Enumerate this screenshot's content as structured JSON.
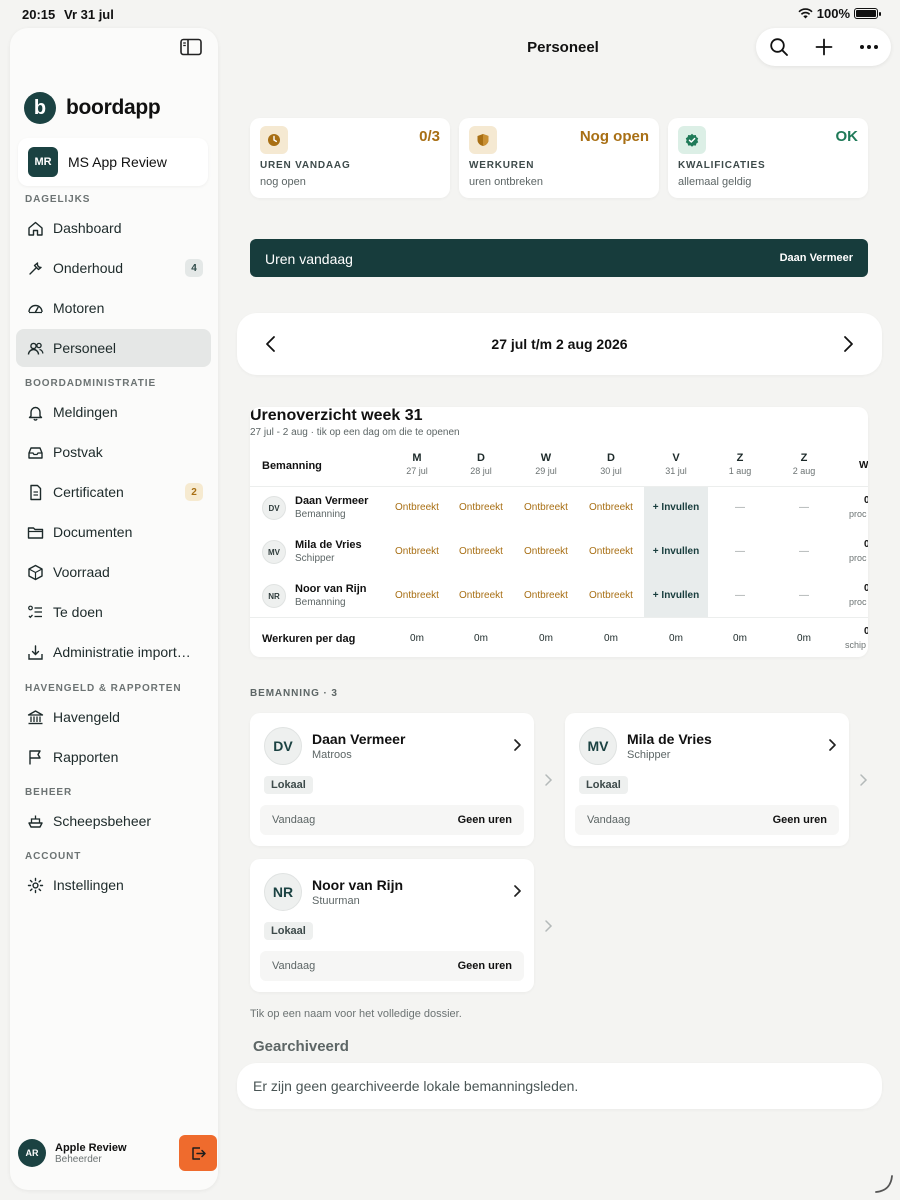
{
  "status_bar": {
    "time": "20:15",
    "date": "Vr 31 jul",
    "battery": "100%"
  },
  "sidebar": {
    "brand": "boordapp",
    "brand_logo": "b",
    "ship": {
      "initials": "MR",
      "name": "MS App Review"
    },
    "sections": {
      "daily": "DAGELIJKS",
      "admin": "BOORDADMINISTRATIE",
      "harbor": "HAVENGELD & RAPPORTEN",
      "manage": "BEHEER",
      "account": "ACCOUNT"
    },
    "items": [
      {
        "label": "Dashboard",
        "icon": "home-icon"
      },
      {
        "label": "Onderhoud",
        "icon": "wrench-icon",
        "badge": "4"
      },
      {
        "label": "Motoren",
        "icon": "gauge-icon"
      },
      {
        "label": "Personeel",
        "icon": "people-icon",
        "active": true
      },
      {
        "label": "Meldingen",
        "icon": "bell-icon"
      },
      {
        "label": "Postvak",
        "icon": "inbox-icon"
      },
      {
        "label": "Certificaten",
        "icon": "document-icon",
        "badge": "2"
      },
      {
        "label": "Documenten",
        "icon": "folder-icon"
      },
      {
        "label": "Voorraad",
        "icon": "box-icon"
      },
      {
        "label": "Te doen",
        "icon": "checklist-icon"
      },
      {
        "label": "Administratie import…",
        "icon": "import-icon"
      },
      {
        "label": "Havengeld",
        "icon": "bank-icon"
      },
      {
        "label": "Rapporten",
        "icon": "flag-icon"
      },
      {
        "label": "Scheepsbeheer",
        "icon": "ship-icon"
      },
      {
        "label": "Instellingen",
        "icon": "gear-icon"
      }
    ],
    "user": {
      "initials": "AR",
      "name": "Apple Review",
      "role": "Beheerder"
    }
  },
  "header": {
    "title": "Personeel"
  },
  "stats": [
    {
      "value": "0/3",
      "label": "UREN VANDAAG",
      "sub": "nog open",
      "color": "#a86f14",
      "icon": "clock-icon"
    },
    {
      "value": "Nog open",
      "label": "WERKUREN",
      "sub": "uren ontbreken",
      "color": "#a86f14",
      "icon": "shield-icon"
    },
    {
      "value": "OK",
      "label": "KWALIFICATIES",
      "sub": "allemaal geldig",
      "color": "#1f7a58",
      "icon": "check-shield-icon"
    }
  ],
  "banner": {
    "title": "Uren vandaag",
    "user": "Daan Vermeer"
  },
  "week_nav": {
    "label": "27 jul t/m 2 aug 2026"
  },
  "hours": {
    "title": "Urenoverzicht week 31",
    "subtitle": "27 jul - 2 aug · tik op een dag om die te openen",
    "name_header": "Bemanning",
    "days": [
      {
        "letter": "M",
        "date": "27 jul"
      },
      {
        "letter": "D",
        "date": "28 jul"
      },
      {
        "letter": "W",
        "date": "29 jul"
      },
      {
        "letter": "D",
        "date": "30 jul"
      },
      {
        "letter": "V",
        "date": "31 jul"
      },
      {
        "letter": "Z",
        "date": "1 aug"
      },
      {
        "letter": "Z",
        "date": "2 aug"
      }
    ],
    "edge_header": "W",
    "rows": [
      {
        "initials": "DV",
        "name": "Daan Vermeer",
        "role": "Bemanning",
        "cells": [
          "Ontbreekt",
          "Ontbreekt",
          "Ontbreekt",
          "Ontbreekt",
          "+ Invullen",
          "—",
          "—"
        ],
        "edge": "0",
        "edge_sub": "proc"
      },
      {
        "initials": "MV",
        "name": "Mila de Vries",
        "role": "Schipper",
        "cells": [
          "Ontbreekt",
          "Ontbreekt",
          "Ontbreekt",
          "Ontbreekt",
          "+ Invullen",
          "—",
          "—"
        ],
        "edge": "0",
        "edge_sub": "proc"
      },
      {
        "initials": "NR",
        "name": "Noor van Rijn",
        "role": "Bemanning",
        "cells": [
          "Ontbreekt",
          "Ontbreekt",
          "Ontbreekt",
          "Ontbreekt",
          "+ Invullen",
          "—",
          "—"
        ],
        "edge": "0",
        "edge_sub": "proc"
      }
    ],
    "sum_label": "Werkuren per dag",
    "sums": [
      "0m",
      "0m",
      "0m",
      "0m",
      "0m",
      "0m",
      "0m"
    ],
    "sum_edge": "0",
    "sum_edge_sub": "schip"
  },
  "crew": {
    "heading": "BEMANNING · 3",
    "cards": [
      {
        "initials": "DV",
        "name": "Daan Vermeer",
        "role": "Matroos",
        "tag": "Lokaal",
        "today": "Vandaag",
        "hours": "Geen uren"
      },
      {
        "initials": "MV",
        "name": "Mila de Vries",
        "role": "Schipper",
        "tag": "Lokaal",
        "today": "Vandaag",
        "hours": "Geen uren"
      },
      {
        "initials": "NR",
        "name": "Noor van Rijn",
        "role": "Stuurman",
        "tag": "Lokaal",
        "today": "Vandaag",
        "hours": "Geen uren"
      }
    ],
    "hint": "Tik op een naam voor het volledige dossier."
  },
  "archived": {
    "title": "Gearchiveerd",
    "empty": "Er zijn geen gearchiveerde lokale bemanningsleden."
  }
}
